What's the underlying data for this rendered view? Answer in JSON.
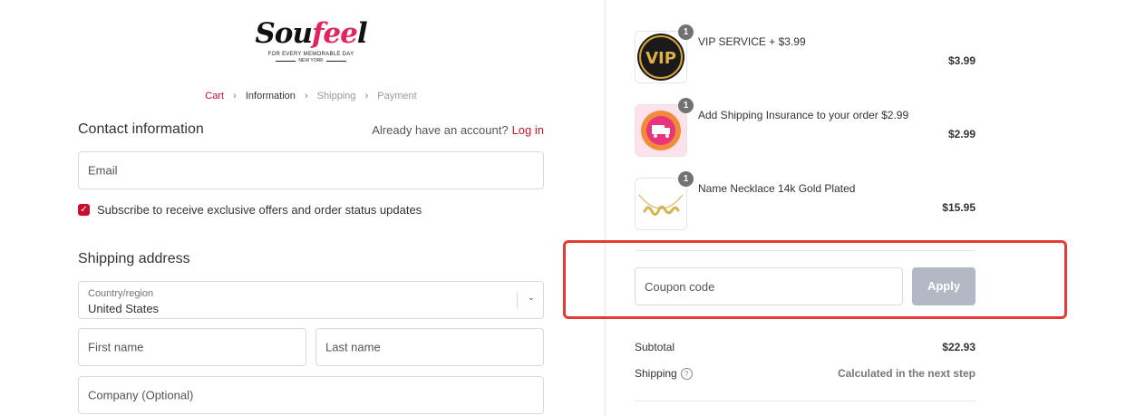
{
  "brand": {
    "name_part1": "Sou",
    "name_part2": "fee",
    "name_part3": "l",
    "tagline": "FOR EVERY MEMORABLE DAY",
    "location": "NEW YORK"
  },
  "breadcrumb": [
    {
      "label": "Cart"
    },
    {
      "label": "Information"
    },
    {
      "label": "Shipping"
    },
    {
      "label": "Payment"
    }
  ],
  "contact": {
    "title": "Contact information",
    "account_prompt": "Already have an account?",
    "login_label": "Log in",
    "email_placeholder": "Email",
    "subscribe_label": "Subscribe to receive exclusive offers and order status updates",
    "subscribe_checked": true
  },
  "shipping": {
    "title": "Shipping address",
    "country_label": "Country/region",
    "country_value": "United States",
    "first_name_placeholder": "First name",
    "last_name_placeholder": "Last name",
    "company_placeholder": "Company (Optional)"
  },
  "cart_items": [
    {
      "name": "VIP SERVICE + $3.99",
      "price": "$3.99",
      "qty": "1",
      "icon": "vip-badge-icon"
    },
    {
      "name": "Add Shipping Insurance to your order $2.99",
      "price": "$2.99",
      "qty": "1",
      "icon": "shipping-insurance-icon"
    },
    {
      "name": "Name Necklace 14k Gold Plated",
      "price": "$15.95",
      "qty": "1",
      "icon": "necklace-icon"
    }
  ],
  "coupon": {
    "placeholder": "Coupon code",
    "apply_label": "Apply"
  },
  "summary": {
    "subtotal_label": "Subtotal",
    "subtotal_value": "$22.93",
    "shipping_label": "Shipping",
    "shipping_value": "Calculated in the next step"
  },
  "colors": {
    "accent": "#c8102e",
    "highlight_border": "#e53935",
    "apply_disabled": "#b3b9c4"
  }
}
